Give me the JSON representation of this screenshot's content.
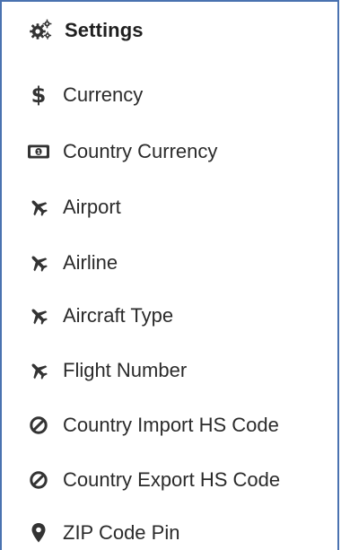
{
  "header": {
    "title": "Settings",
    "icon": "gears-icon"
  },
  "menu": {
    "items": [
      {
        "label": "Currency",
        "icon": "dollar-icon"
      },
      {
        "label": "Country Currency",
        "icon": "money-bill-icon"
      },
      {
        "label": "Airport",
        "icon": "plane-icon"
      },
      {
        "label": "Airline",
        "icon": "plane-icon"
      },
      {
        "label": "Aircraft Type",
        "icon": "plane-icon"
      },
      {
        "label": "Flight Number",
        "icon": "plane-icon"
      },
      {
        "label": "Country Import HS Code",
        "icon": "ban-icon"
      },
      {
        "label": "Country Export HS Code",
        "icon": "ban-icon"
      },
      {
        "label": "ZIP Code Pin",
        "icon": "map-marker-icon"
      }
    ]
  },
  "colors": {
    "panel_border": "#4a72b0",
    "text": "#2b2b2b",
    "icon": "#333333"
  }
}
